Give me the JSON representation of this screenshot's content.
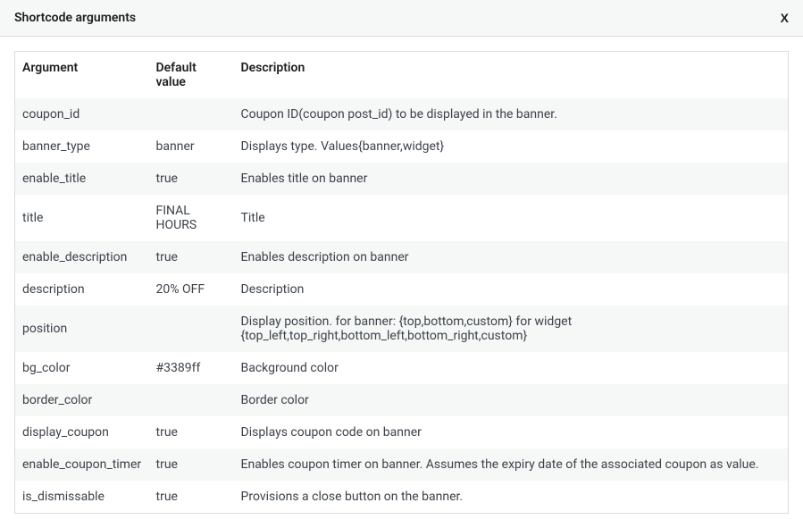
{
  "header": {
    "title": "Shortcode arguments",
    "close_label": "X"
  },
  "table": {
    "columns": [
      {
        "label": "Argument"
      },
      {
        "label": "Default value"
      },
      {
        "label": "Description"
      }
    ],
    "rows": [
      {
        "argument": "coupon_id",
        "default_value": "",
        "description": "Coupon ID(coupon post_id) to be displayed in the banner."
      },
      {
        "argument": "banner_type",
        "default_value": "banner",
        "description": "Displays type. Values{banner,widget}"
      },
      {
        "argument": "enable_title",
        "default_value": "true",
        "description": "Enables title on banner"
      },
      {
        "argument": "title",
        "default_value": "FINAL HOURS",
        "description": "Title"
      },
      {
        "argument": "enable_description",
        "default_value": "true",
        "description": "Enables description on banner"
      },
      {
        "argument": "description",
        "default_value": "20% OFF",
        "description": "Description"
      },
      {
        "argument": "position",
        "default_value": "",
        "description": "Display position. for banner: {top,bottom,custom} for widget {top_left,top_right,bottom_left,bottom_right,custom}"
      },
      {
        "argument": "bg_color",
        "default_value": "#3389ff",
        "description": "Background color"
      },
      {
        "argument": "border_color",
        "default_value": "",
        "description": "Border color"
      },
      {
        "argument": "display_coupon",
        "default_value": "true",
        "description": "Displays coupon code on banner"
      },
      {
        "argument": "enable_coupon_timer",
        "default_value": "true",
        "description": "Enables coupon timer on banner. Assumes the expiry date of the associated coupon as value."
      },
      {
        "argument": "is_dismissable",
        "default_value": "true",
        "description": "Provisions a close button on the banner."
      }
    ]
  }
}
